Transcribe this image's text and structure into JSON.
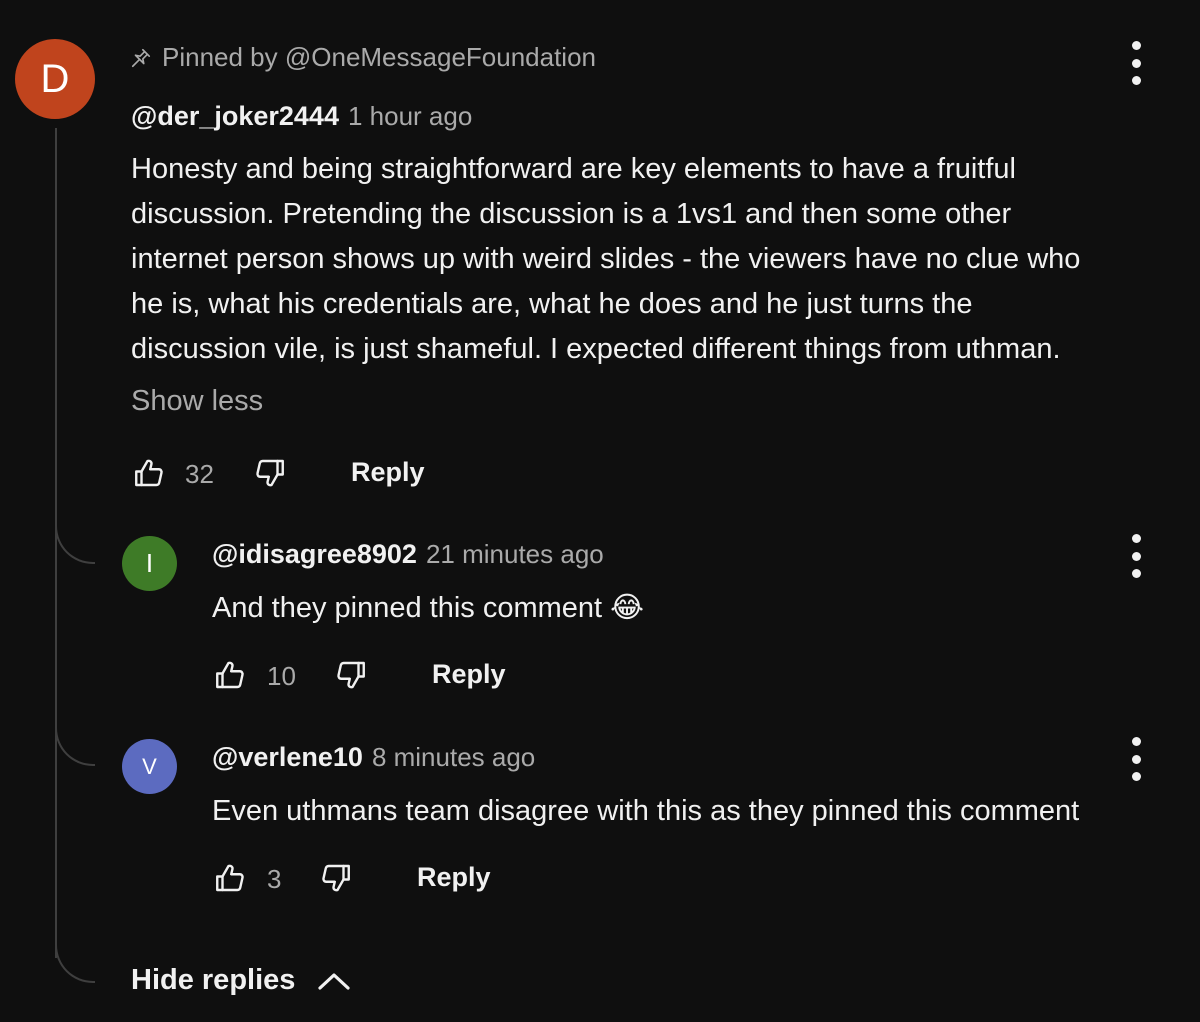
{
  "comment": {
    "avatar_letter": "D",
    "avatar_color": "#c0441d",
    "pinned_text": "Pinned by @OneMessageFoundation",
    "pin_icon": "pin-icon",
    "author": "@der_joker2444",
    "time": "1 hour ago",
    "text_lines": [
      "Honesty and being straightforward are key elements to have a fruitful",
      "discussion. Pretending the discussion is a 1vs1 and then some other",
      "internet person shows up with weird slides - the viewers have no clue who",
      "he is, what his credentials are, what he does and he just turns the",
      "discussion vile, is just shameful. I expected different things from uthman."
    ],
    "show_less": "Show less",
    "likes": "32",
    "reply_label": "Reply"
  },
  "replies": [
    {
      "avatar_letter": "I",
      "avatar_color": "#3e7b27",
      "author": "@idisagree8902",
      "time": "21 minutes ago",
      "text": "And they pinned this comment 😂",
      "likes": "10",
      "reply_label": "Reply"
    },
    {
      "avatar_letter": "V",
      "avatar_color": "#5c6bc0",
      "author": "@verlene10",
      "time": "8 minutes ago",
      "text": "Even uthmans team disagree with this as they pinned this comment",
      "likes": "3",
      "reply_label": "Reply"
    }
  ],
  "hide_replies": "Hide replies",
  "colors": {
    "background": "#0f0f0f",
    "primary_text": "#f1f1f1",
    "secondary_text": "#aaaaaa",
    "thread_line": "#3f3f3f"
  }
}
